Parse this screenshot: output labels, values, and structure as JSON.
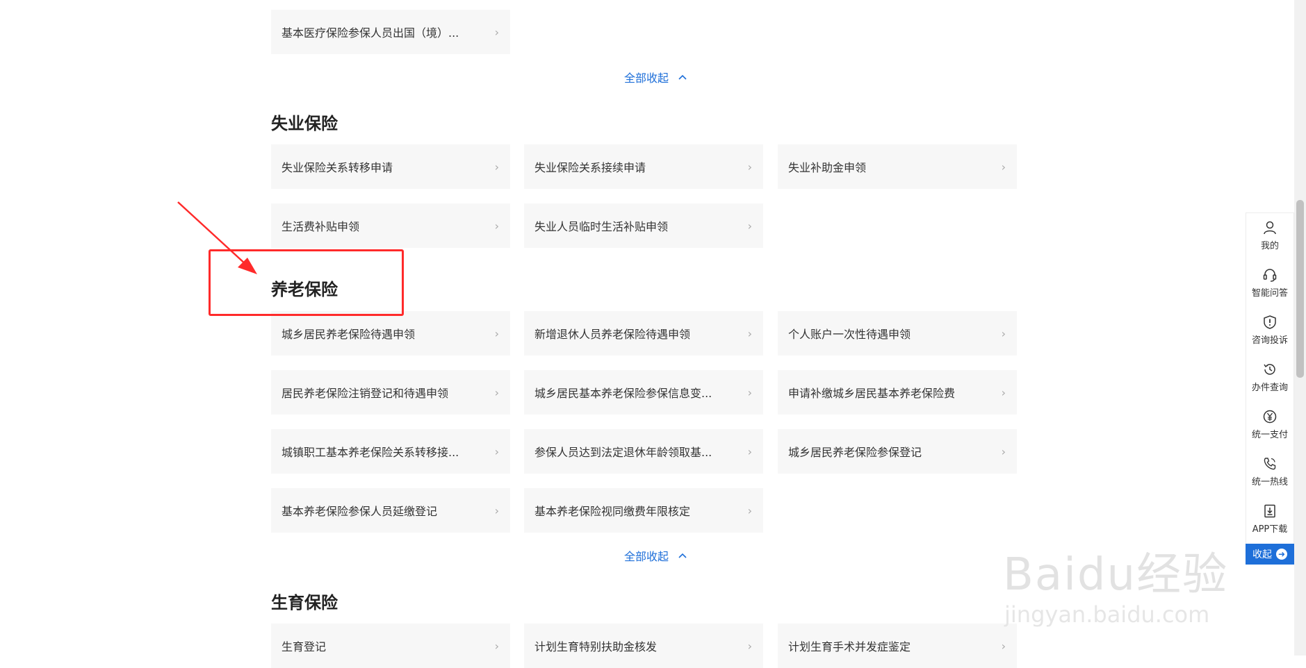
{
  "top_item": {
    "label": "基本医疗保险参保人员出国（境）..."
  },
  "collapse_label": "全部收起",
  "sections": {
    "unemployment": {
      "title": "失业保险",
      "items": [
        "失业保险关系转移申请",
        "失业保险关系接续申请",
        "失业补助金申领",
        "生活费补贴申领",
        "失业人员临时生活补贴申领"
      ]
    },
    "pension": {
      "title": "养老保险",
      "items": [
        "城乡居民养老保险待遇申领",
        "新增退休人员养老保险待遇申领",
        "个人账户一次性待遇申领",
        "居民养老保险注销登记和待遇申领",
        "城乡居民基本养老保险参保信息变...",
        "申请补缴城乡居民基本养老保险费",
        "城镇职工基本养老保险关系转移接...",
        "参保人员达到法定退休年龄领取基...",
        "城乡居民养老保险参保登记",
        "基本养老保险参保人员延缴登记",
        "基本养老保险视同缴费年限核定"
      ]
    },
    "maternity": {
      "title": "生育保险",
      "items": [
        "生育登记",
        "计划生育特别扶助金核发",
        "计划生育手术并发症鉴定"
      ]
    }
  },
  "sidebar": {
    "items": [
      {
        "label": "我的",
        "icon": "user-icon"
      },
      {
        "label": "智能问答",
        "icon": "headset-icon"
      },
      {
        "label": "咨询投诉",
        "icon": "shield-alert-icon"
      },
      {
        "label": "办件查询",
        "icon": "history-icon"
      },
      {
        "label": "统一支付",
        "icon": "yen-icon"
      },
      {
        "label": "统一热线",
        "icon": "phone-icon"
      },
      {
        "label": "APP下载",
        "icon": "download-icon"
      }
    ],
    "collapse_label": "收起"
  },
  "watermark": {
    "brand": "Baidu经验",
    "url": "jingyan.baidu.com"
  },
  "colors": {
    "link": "#1e6fd9",
    "annotation": "#ff2a2a",
    "tile_bg": "#f7f7f7"
  }
}
